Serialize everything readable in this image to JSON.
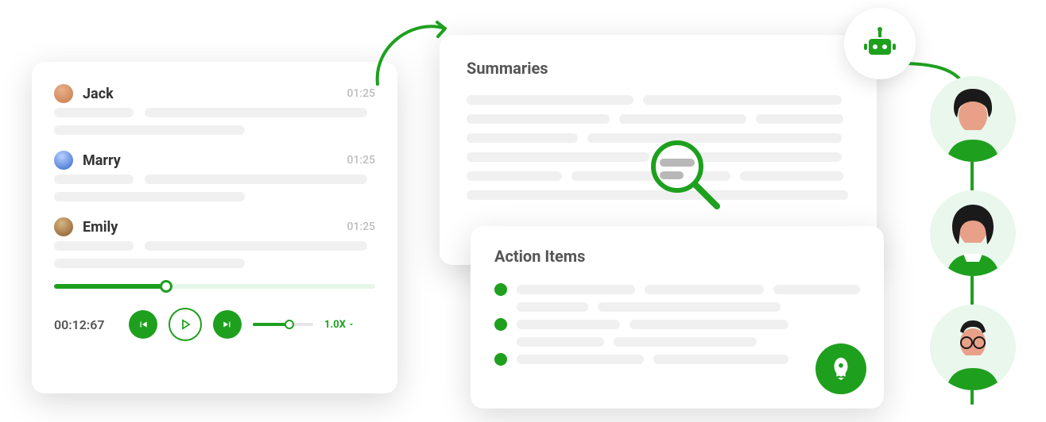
{
  "colors": {
    "accent": "#1ea01e",
    "muted": "#f0f0f0",
    "text": "#333333"
  },
  "transcript": {
    "entries": [
      {
        "name": "Jack",
        "time": "01:25",
        "avatar_bg": "#c97b4a"
      },
      {
        "name": "Marry",
        "time": "01:25",
        "avatar_bg": "#3366cc"
      },
      {
        "name": "Emily",
        "time": "01:25",
        "avatar_bg": "#8a5a2b"
      }
    ],
    "progress_pct": 35,
    "player": {
      "current_time": "00:12:67",
      "speed_label": "1.0X",
      "volume_pct": 60
    }
  },
  "summaries": {
    "title": "Summaries"
  },
  "action_items": {
    "title": "Action Items",
    "count": 3
  },
  "icons": {
    "robot": "robot-icon",
    "magnify": "magnify-icon",
    "rocket": "rocket-icon",
    "prev": "skip-prev-icon",
    "play": "play-icon",
    "next": "skip-next-icon",
    "caret": "caret-down-icon"
  }
}
